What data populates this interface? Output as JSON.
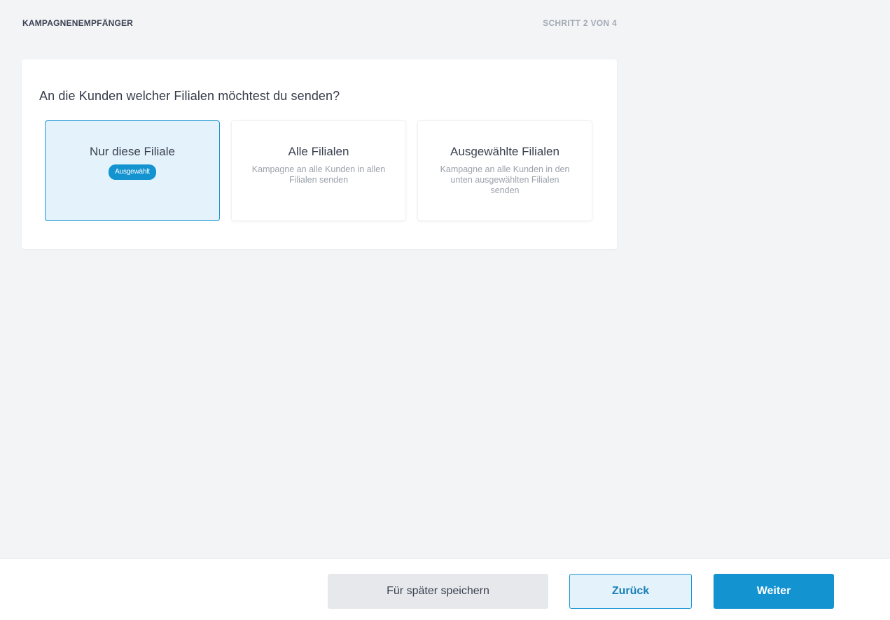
{
  "header": {
    "section_title": "KAMPAGNENEMPFÄNGER",
    "step_indicator": "SCHRITT 2 VON 4"
  },
  "question": "An die Kunden welcher Filialen möchtest du senden?",
  "options": [
    {
      "title": "Nur diese Filiale",
      "description": "",
      "badge": "Ausgewählt",
      "selected": true
    },
    {
      "title": "Alle Filialen",
      "description": "Kampagne an alle Kunden in allen Filialen senden",
      "selected": false
    },
    {
      "title": "Ausgewählte Filialen",
      "description": "Kampagne an alle Kunden in den unten ausgewählten Filialen senden",
      "selected": false
    }
  ],
  "footer": {
    "save_label": "Für später speichern",
    "back_label": "Zurück",
    "next_label": "Weiter"
  },
  "colors": {
    "accent": "#1493d1",
    "selected_bg": "#e4f3fb",
    "page_bg": "#f3f4f6"
  }
}
